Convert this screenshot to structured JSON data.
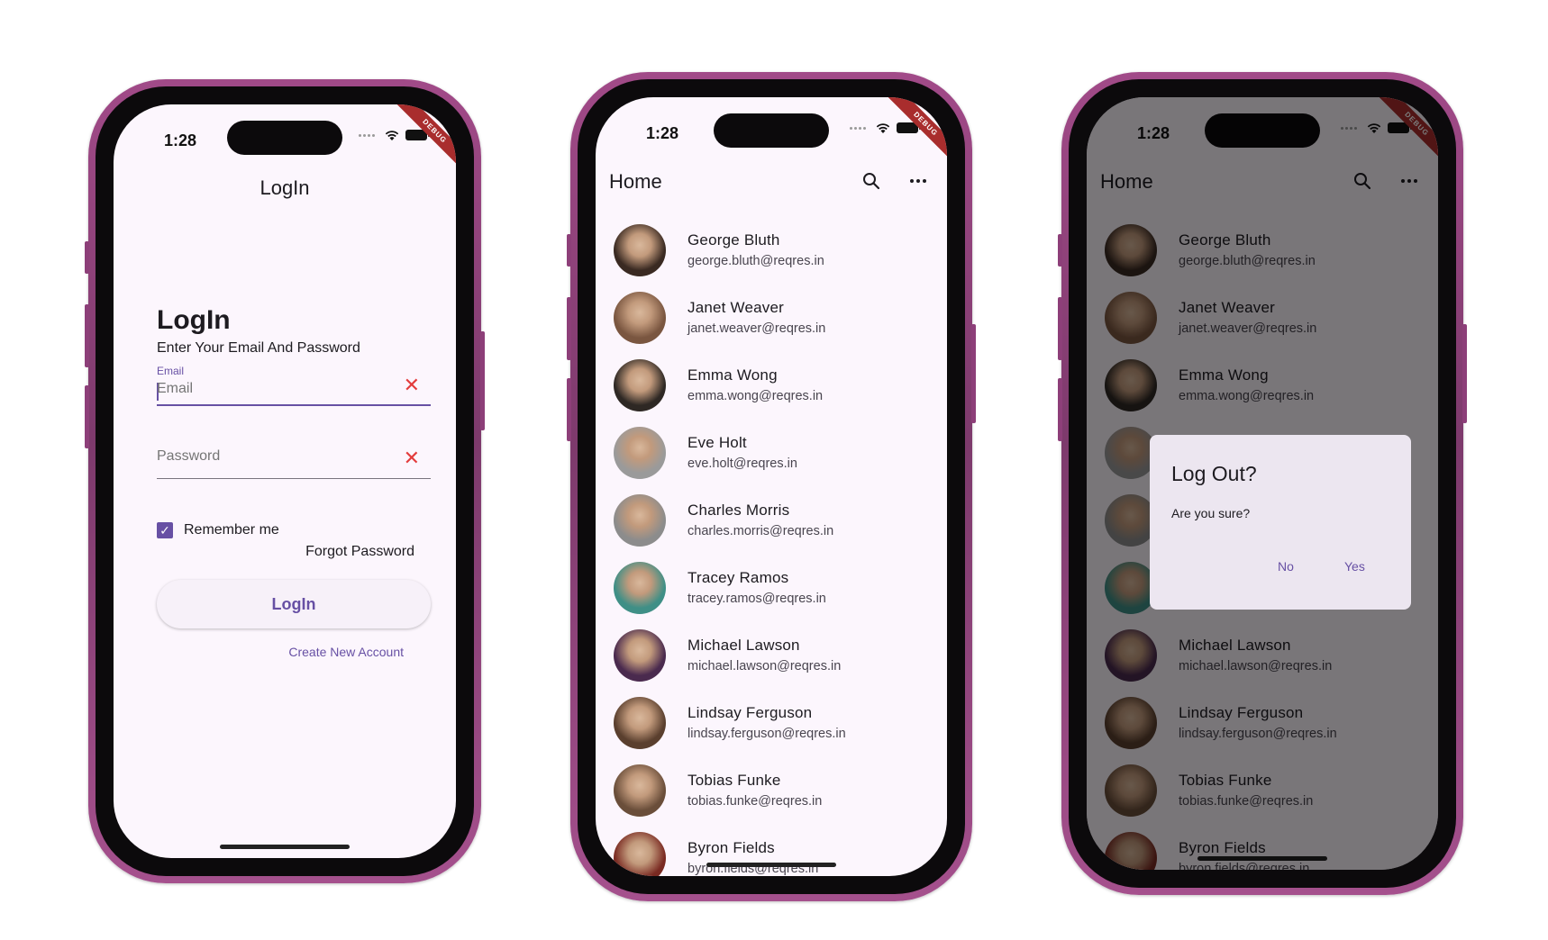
{
  "status": {
    "time": "1:28",
    "debug_label": "DEBUG"
  },
  "login": {
    "appbar_title": "LogIn",
    "heading": "LogIn",
    "subtitle": "Enter Your Email And Password",
    "email_label": "Email",
    "email_placeholder": "Email",
    "password_placeholder": "Password",
    "remember_label": "Remember me",
    "remember_checked": true,
    "forgot_label": "Forgot Password",
    "login_button": "LogIn",
    "create_account": "Create New Account"
  },
  "home": {
    "title": "Home",
    "users": [
      {
        "name": "George Bluth",
        "email": "george.bluth@reqres.in",
        "avatar_color": "#3a2a22"
      },
      {
        "name": "Janet Weaver",
        "email": "janet.weaver@reqres.in",
        "avatar_color": "#7a5640"
      },
      {
        "name": "Emma Wong",
        "email": "emma.wong@reqres.in",
        "avatar_color": "#2e2824"
      },
      {
        "name": "Eve Holt",
        "email": "eve.holt@reqres.in",
        "avatar_color": "#9a9a9a"
      },
      {
        "name": "Charles Morris",
        "email": "charles.morris@reqres.in",
        "avatar_color": "#8c8c8c"
      },
      {
        "name": "Tracey Ramos",
        "email": "tracey.ramos@reqres.in",
        "avatar_color": "#3f8f86"
      },
      {
        "name": "Michael Lawson",
        "email": "michael.lawson@reqres.in",
        "avatar_color": "#4a2a4e"
      },
      {
        "name": "Lindsay Ferguson",
        "email": "lindsay.ferguson@reqres.in",
        "avatar_color": "#5a3f2e"
      },
      {
        "name": "Tobias Funke",
        "email": "tobias.funke@reqres.in",
        "avatar_color": "#6a4e3a"
      },
      {
        "name": "Byron Fields",
        "email": "byron.fields@reqres.in",
        "avatar_color": "#7a2a22"
      }
    ]
  },
  "dialog": {
    "title": "Log Out?",
    "body": "Are you sure?",
    "no_label": "No",
    "yes_label": "Yes"
  }
}
